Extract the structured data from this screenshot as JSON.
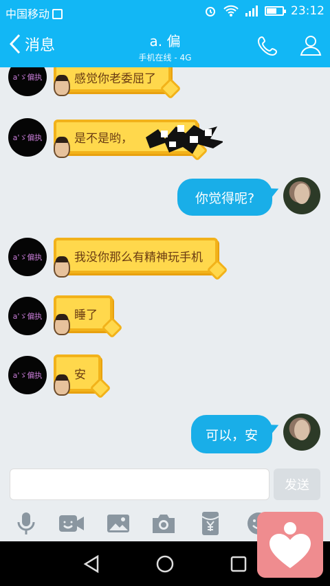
{
  "status_bar": {
    "carrier": "中国移动",
    "time": "23:12",
    "battery_level": 0.6
  },
  "header": {
    "back_label": "消息",
    "title": "a. 偏",
    "subtitle": "手机在线 - 4G"
  },
  "contact_avatar_text": "a'ゞ偏执",
  "messages": [
    {
      "side": "left",
      "text": "感觉你老委屈了"
    },
    {
      "side": "left",
      "text": "是不是哟，"
    },
    {
      "side": "right",
      "text": "你觉得呢?"
    },
    {
      "side": "left",
      "text": "我没你那么有精神玩手机"
    },
    {
      "side": "left",
      "text": "睡了"
    },
    {
      "side": "left",
      "text": "安"
    },
    {
      "side": "right",
      "text": "可以，安"
    }
  ],
  "composer": {
    "send_label": "发送",
    "input_value": ""
  },
  "colors": {
    "brand": "#12b7f5",
    "bubble_right": "#19aee8",
    "bubble_left_fill": "#ffd84c",
    "bubble_left_border": "#f2b21a"
  },
  "toolbar_icons": [
    "microphone-icon",
    "video-call-icon",
    "image-icon",
    "camera-icon",
    "red-packet-icon",
    "emoji-icon"
  ],
  "nav_icons": [
    "back-triangle-icon",
    "home-circle-icon",
    "recents-square-icon"
  ]
}
